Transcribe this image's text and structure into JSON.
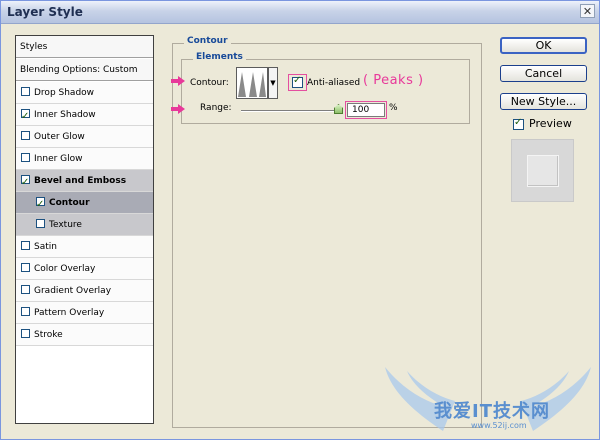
{
  "window": {
    "title": "Layer Style",
    "close_glyph": "✕"
  },
  "styles_list": {
    "header": "Styles",
    "blending": "Blending Options: Custom",
    "items": [
      {
        "label": "Drop Shadow",
        "checked": false
      },
      {
        "label": "Inner Shadow",
        "checked": true
      },
      {
        "label": "Outer Glow",
        "checked": false
      },
      {
        "label": "Inner Glow",
        "checked": false
      },
      {
        "label": "Bevel and Emboss",
        "checked": true
      },
      {
        "label": "Contour",
        "checked": true
      },
      {
        "label": "Texture",
        "checked": false
      },
      {
        "label": "Satin",
        "checked": false
      },
      {
        "label": "Color Overlay",
        "checked": false
      },
      {
        "label": "Gradient Overlay",
        "checked": false
      },
      {
        "label": "Pattern Overlay",
        "checked": false
      },
      {
        "label": "Stroke",
        "checked": false
      }
    ]
  },
  "panel": {
    "group_title": "Contour",
    "elements_title": "Elements",
    "contour_label": "Contour:",
    "anti_aliased_label": "Anti-aliased",
    "anti_aliased_checked": true,
    "annotation": "( Peaks )",
    "range_label": "Range:",
    "range_value": "100",
    "range_unit": "%",
    "range_fraction": 1.0
  },
  "buttons": {
    "ok": "OK",
    "cancel": "Cancel",
    "new_style": "New Style...",
    "preview_label": "Preview",
    "preview_checked": true
  },
  "watermark": {
    "text": "我爱IT技术网",
    "url": "www.52ij.com"
  },
  "colors": {
    "accent_title": "#184a99",
    "annotation": "#e8399a",
    "arrow": "#e8399a",
    "watermark": "#5a8fcf"
  }
}
